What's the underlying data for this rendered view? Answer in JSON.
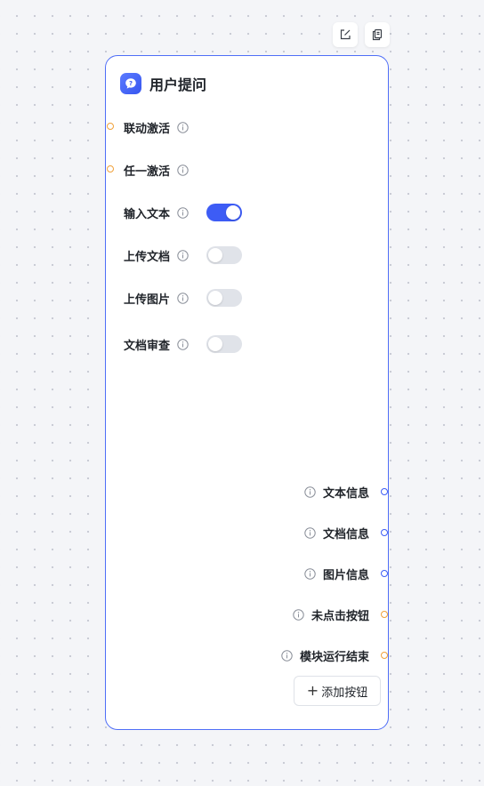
{
  "toolbar": {
    "edit_icon": "edit-icon",
    "copy_icon": "copy-icon"
  },
  "node": {
    "title": "用户提问",
    "icon": "question-bubble-icon",
    "accent_color": "#4f6ef7",
    "inputs": [
      {
        "label": "联动激活",
        "port_color": "#f0a13a"
      },
      {
        "label": "任一激活",
        "port_color": "#f0a13a"
      }
    ],
    "toggles": [
      {
        "label": "输入文本",
        "enabled": true
      },
      {
        "label": "上传文档",
        "enabled": false
      },
      {
        "label": "上传图片",
        "enabled": false
      },
      {
        "label": "文档审查",
        "enabled": false
      }
    ],
    "outputs": [
      {
        "label": "文本信息",
        "port_color": "#3d5cf5"
      },
      {
        "label": "文档信息",
        "port_color": "#3d5cf5"
      },
      {
        "label": "图片信息",
        "port_color": "#3d5cf5"
      },
      {
        "label": "未点击按钮",
        "port_color": "#f0a13a"
      },
      {
        "label": "模块运行结束",
        "port_color": "#f0a13a"
      }
    ],
    "add_button": {
      "plus": "+",
      "label": "添加按钮"
    }
  }
}
